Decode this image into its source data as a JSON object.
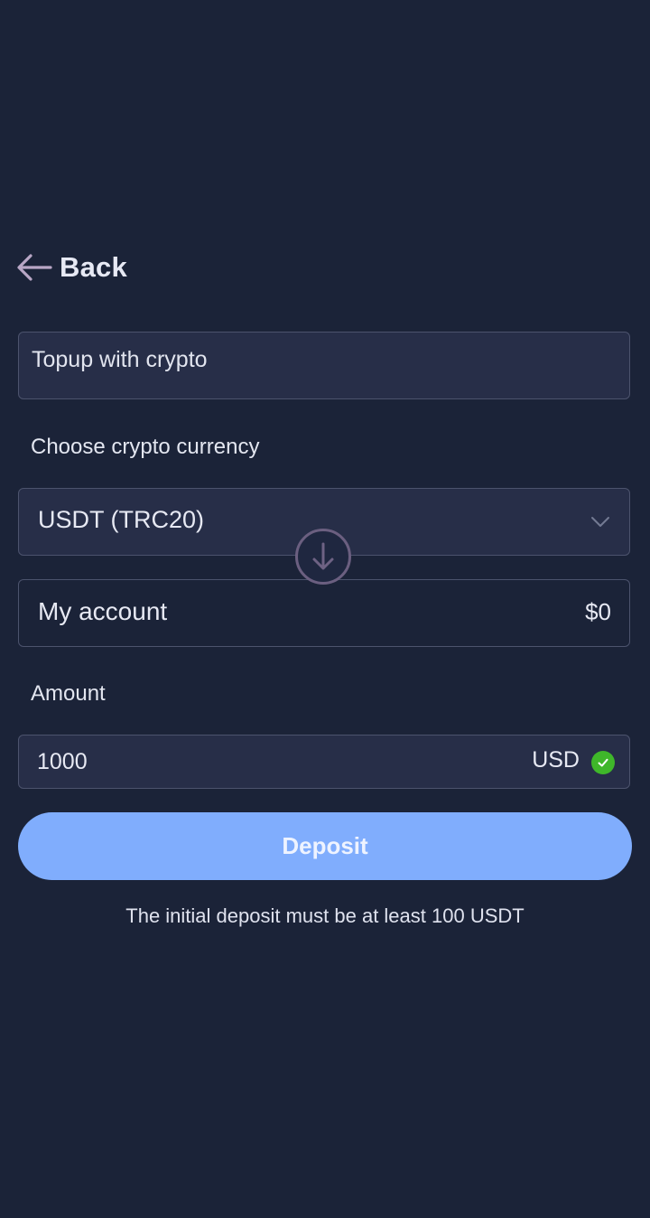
{
  "header": {
    "back_label": "Back"
  },
  "method": {
    "title": "Topup with crypto"
  },
  "currency": {
    "label": "Choose crypto currency",
    "selected": "USDT (TRC20)"
  },
  "account": {
    "name": "My account",
    "balance": "$0"
  },
  "amount": {
    "label": "Amount",
    "value": "1000",
    "unit": "USD",
    "valid": true
  },
  "deposit": {
    "button_label": "Deposit",
    "note": "The initial deposit must be at least 100 USDT"
  },
  "colors": {
    "background": "#1b2338",
    "field": "#272e48",
    "border": "#4c536d",
    "primary_button": "#80adfd",
    "success": "#3fb72a",
    "swap_ring": "#6b5f80"
  },
  "icons": {
    "back": "arrow-left-icon",
    "dropdown": "chevron-down-icon",
    "swap": "arrow-down-circle-icon",
    "valid": "check-circle-icon"
  }
}
